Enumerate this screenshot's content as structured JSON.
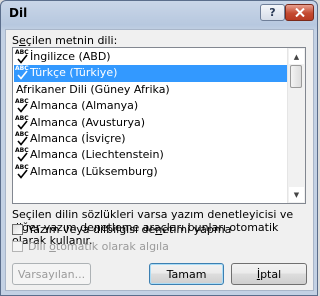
{
  "window": {
    "title": "Dil"
  },
  "titlebar": {
    "help_label": "?",
    "close_label": "x"
  },
  "language_list": {
    "label_prefix": "S",
    "label_accel": "e",
    "label_rest": "çilen metnin dili:",
    "items": [
      {
        "label": "İngilizce (ABD)",
        "spell": true,
        "selected": false
      },
      {
        "label": "Türkçe (Türkiye)",
        "spell": true,
        "selected": true
      },
      {
        "label": "Afrikaner Dili (Güney Afrika)",
        "spell": false,
        "selected": false
      },
      {
        "label": "Almanca (Almanya)",
        "spell": true,
        "selected": false
      },
      {
        "label": "Almanca (Avusturya)",
        "spell": true,
        "selected": false
      },
      {
        "label": "Almanca (İsviçre)",
        "spell": true,
        "selected": false
      },
      {
        "label": "Almanca (Liechtenstein)",
        "spell": true,
        "selected": false
      },
      {
        "label": "Almanca (Lüksemburg)",
        "spell": true,
        "selected": false
      }
    ]
  },
  "description": "Seçilen dilin sözlükleri varsa yazım denetleyicisi ve diğer yazım denetleme araçları bunları otomatik olarak kullanır.",
  "options": {
    "no_proofing_prefix": "Yazım veya dilbilgisi de",
    "no_proofing_accel": "n",
    "no_proofing_rest": "etimi yapma",
    "no_proofing_checked": false,
    "detect_prefix": "Dili ",
    "detect_accel": "o",
    "detect_rest": "tomatik olarak algıla",
    "detect_checked": false,
    "detect_enabled": false
  },
  "buttons": {
    "default_label": "Varsayılan...",
    "ok_label": "Tamam",
    "cancel_prefix": "",
    "cancel_accel": "İ",
    "cancel_rest": "ptal"
  },
  "icons": {
    "spell": "abc-spellcheck-icon"
  }
}
